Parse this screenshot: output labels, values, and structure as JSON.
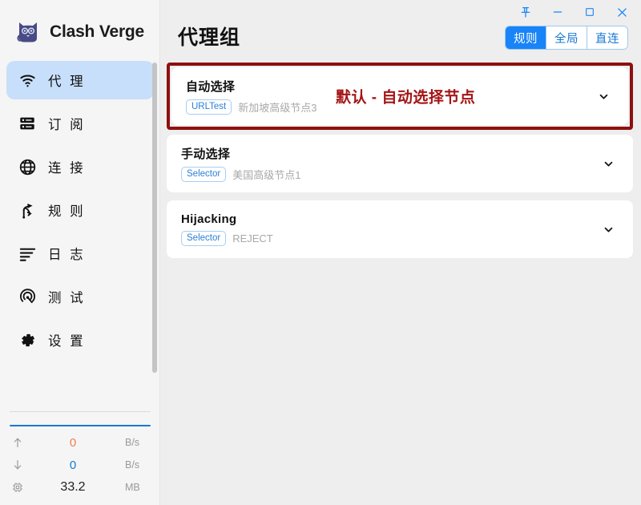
{
  "app": {
    "brand": "Clash Verge",
    "logo_icon": "cat-logo-icon"
  },
  "titlebar": {
    "pin_label": "\u0000",
    "buttons": [
      {
        "name": "pin-button",
        "icon": "pin-icon"
      },
      {
        "name": "minimize-button",
        "icon": "minimize-icon"
      },
      {
        "name": "maximize-button",
        "icon": "maximize-icon"
      },
      {
        "name": "close-button",
        "icon": "close-icon"
      }
    ]
  },
  "sidebar": {
    "items": [
      {
        "label": "代 理",
        "icon": "wifi-icon",
        "active": true
      },
      {
        "label": "订 阅",
        "icon": "subscription-icon",
        "active": false
      },
      {
        "label": "连 接",
        "icon": "globe-icon",
        "active": false
      },
      {
        "label": "规 则",
        "icon": "rules-branch-icon",
        "active": false
      },
      {
        "label": "日 志",
        "icon": "logs-lines-icon",
        "active": false
      },
      {
        "label": "测 试",
        "icon": "radar-test-icon",
        "active": false
      },
      {
        "label": "设 置",
        "icon": "gear-icon",
        "active": false
      }
    ],
    "stats": [
      {
        "icon": "upload-arrow-icon",
        "value": "0",
        "unit": "B/s",
        "kind": "up"
      },
      {
        "icon": "download-arrow-icon",
        "value": "0",
        "unit": "B/s",
        "kind": "down"
      },
      {
        "icon": "memory-chip-icon",
        "value": "33.2",
        "unit": "MB",
        "kind": "mem"
      }
    ]
  },
  "header": {
    "title": "代理组",
    "tabs": [
      {
        "label": "规则",
        "active": true
      },
      {
        "label": "全局",
        "active": false
      },
      {
        "label": "直连",
        "active": false
      }
    ]
  },
  "main": {
    "groups": [
      {
        "title": "自动选择",
        "type_chip": "URLTest",
        "current_node": "新加坡高级节点3",
        "annotation": "默认 - 自动选择节点",
        "highlighted": true,
        "chevron_icon": "chevron-down-icon"
      },
      {
        "title": "手动选择",
        "type_chip": "Selector",
        "current_node": "美国高级节点1",
        "annotation": "",
        "highlighted": false,
        "chevron_icon": "chevron-down-icon"
      },
      {
        "title": "Hijacking",
        "type_chip": "Selector",
        "current_node": "REJECT",
        "annotation": "",
        "highlighted": false,
        "chevron_icon": "chevron-down-icon"
      }
    ]
  },
  "colors": {
    "accent_blue": "#1878d4",
    "tab_active_blue": "#1884f7",
    "sidebar_active": "#c7dffa",
    "annotation_red": "#a31515",
    "highlight_border_red": "#8e0f0f",
    "upload_orange": "#ef7d54"
  }
}
